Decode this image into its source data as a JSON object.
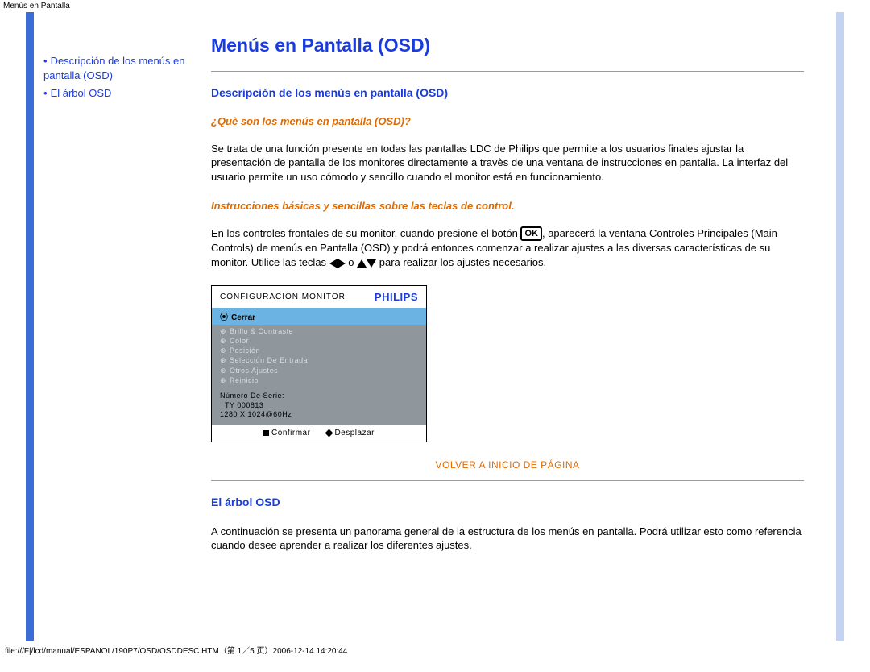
{
  "header_text": "Menús en Pantalla",
  "sidebar": {
    "items": [
      {
        "label": "Descripción de los menús en pantalla (OSD)"
      },
      {
        "label": "El árbol OSD"
      }
    ]
  },
  "main": {
    "title": "Menús en Pantalla (OSD)",
    "section1": {
      "heading": "Descripción de los menús en pantalla (OSD)",
      "sub1": "¿Què son los menús en pantalla (OSD)?",
      "para1": "Se trata de una función presente en todas las pantallas LDC de Philips que permite a los usuarios finales ajustar la presentación de pantalla de los monitores directamente a travès de una ventana de instrucciones en pantalla. La interfaz del usuario permite un uso cómodo y sencillo cuando el monitor está en funcionamiento.",
      "sub2": "Instrucciones básicas y sencillas sobre las teclas de control.",
      "para2_a": "En los controles frontales de su monitor, cuando presione el botón ",
      "ok": "OK",
      "para2_b": ", aparecerá la ventana Controles Principales (Main Controls) de menús en Pantalla (OSD) y podrá entonces comenzar a realizar ajustes a las diversas características de su monitor. Utilice las teclas ",
      "para2_c": " o ",
      "para2_d": " para realizar los ajustes necesarios."
    },
    "osd": {
      "config_label": "CONFIGURACIÓN MONITOR",
      "brand": "PHILIPS",
      "active": "Cerrar",
      "items": [
        "Brillo & Contraste",
        "Color",
        "Posición",
        "Selección De Entrada",
        "Otros Ajustes",
        "Reinicio"
      ],
      "serial_label": "Número De Serie:",
      "serial_value": "TY 000813",
      "res": "1280 X 1024@60Hz",
      "confirm": "Confirmar",
      "scroll": "Desplazar"
    },
    "back_top": "VOLVER A INICIO DE PÁGINA",
    "section2": {
      "heading": "El árbol OSD",
      "para": "A continuación se presenta un panorama general de la estructura de los menús en pantalla. Podrá utilizar esto como referencia cuando desee aprender a realizar los diferentes ajustes."
    }
  },
  "footer": "file:///F|/lcd/manual/ESPANOL/190P7/OSD/OSDDESC.HTM（第 1／5 页）2006-12-14 14:20:44"
}
